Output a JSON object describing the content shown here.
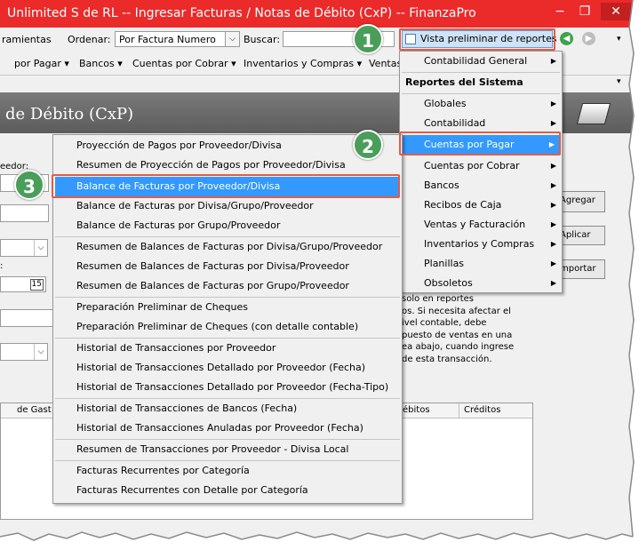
{
  "window": {
    "title": "Unlimited S de RL -- Ingresar Facturas / Notas de Débito (CxP) -- FinanzaPro",
    "controls": {
      "minimize": "−",
      "restore": "❐",
      "close": "✕"
    }
  },
  "toolbar": {
    "herramientas": "ramientas",
    "ordenar_label": "Ordenar:",
    "ordenar_value": "Por Factura Numero",
    "buscar_label": "Buscar:",
    "preview_label": "Vista preliminar de reportes"
  },
  "menubar": {
    "items": [
      "por Pagar ▾",
      "Bancos ▾",
      "Cuentas por Cobrar ▾",
      "Inventarios y Compras ▾",
      "Ventas"
    ]
  },
  "header": {
    "title": "de Débito (CxP)"
  },
  "form": {
    "proveedor_label": "eedor:",
    "date_suffix": "15",
    "buttons": {
      "agregar": "Agregar",
      "aplicar": "Aplicar",
      "importar": "mportar"
    },
    "note_lines": [
      "solo en reportes",
      "os. Si necesita afectar el",
      "ivel contable, debe",
      "puesto de ventas en una",
      "ea abajo, cuando ingrese",
      "de esta transacción."
    ],
    "grid": {
      "col_gasto": "de Gast",
      "col_debitos": "ébitos",
      "col_creditos": "Créditos"
    }
  },
  "reports_menu": {
    "top_items": [
      "Contabilidad General"
    ],
    "section_title": "Reportes del Sistema",
    "items": [
      "Globales",
      "Contabilidad",
      "Cuentas por Pagar",
      "Cuentas por Cobrar",
      "Bancos",
      "Recibos de Caja",
      "Ventas y Facturación",
      "Inventarios y Compras",
      "Planillas",
      "Obsoletos"
    ]
  },
  "cxp_menu": {
    "items": [
      "Proyección de Pagos por Proveedor/Divisa",
      "Resumen de Proyección de Pagos por Proveedor/Divisa",
      "Balance de Facturas por Proveedor/Divisa",
      "Balance de Facturas por Divisa/Grupo/Proveedor",
      "Balance de Facturas por Grupo/Proveedor",
      "Resumen de Balances de Facturas por Divisa/Grupo/Proveedor",
      "Resumen de Balances de Facturas por Divisa/Proveedor",
      "Resumen de Balances de Facturas por Grupo/Proveedor",
      "Preparación Preliminar de Cheques",
      "Preparación Preliminar de Cheques (con detalle contable)",
      "Historial de Transacciones por Proveedor",
      "Historial de Transacciones Detallado por Proveedor (Fecha)",
      "Historial de Transacciones Detallado por Proveedor (Fecha-Tipo)",
      "Historial de Transacciones de Bancos (Fecha)",
      "Historial de Transacciones Anuladas por Proveedor (Fecha)",
      "Resumen de Transacciones por Proveedor - Divisa Local",
      "Facturas Recurrentes por Categoría",
      "Facturas Recurrentes con Detalle por Categoría"
    ]
  },
  "callouts": [
    "1",
    "2",
    "3"
  ],
  "colors": {
    "titlebar": "#eb2a2a",
    "highlight": "#3399ff",
    "callout": "#4a9e5a",
    "callout_border": "#e35b46"
  }
}
